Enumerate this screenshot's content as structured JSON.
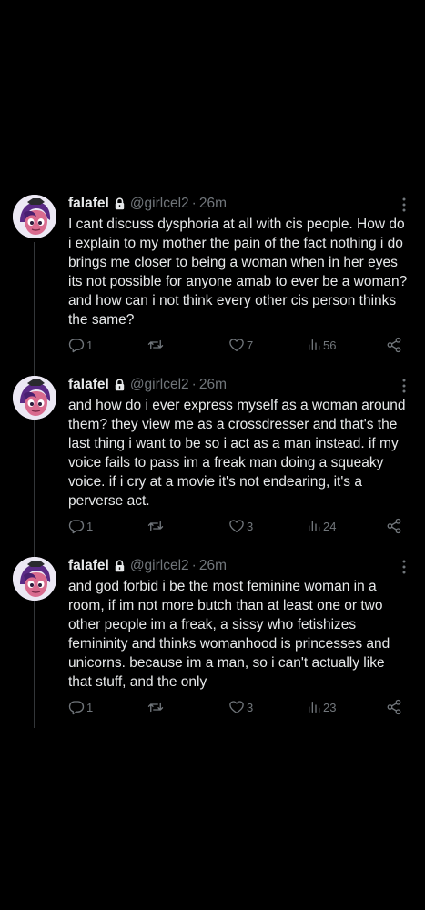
{
  "colors": {
    "background": "#000000",
    "text": "#e7e9ea",
    "muted": "#71767b",
    "thread_line": "#333639",
    "avatar_hair": "#5b2a86",
    "avatar_skin": "#d96b8f"
  },
  "tweets": [
    {
      "author_name": "falafel",
      "handle": "@girlcel2",
      "separator": "·",
      "time": "26m",
      "lines": [
        "I cant discuss dysphoria at all with cis people. How do",
        "i explain to my mother the pain of the fact nothing i do",
        "brings me closer to being a woman when in her eyes",
        "its not possible for anyone amab to ever be a woman?",
        "and how can i not think every other cis person thinks",
        "the same?"
      ],
      "replies": "1",
      "reposts": "",
      "likes": "7",
      "views": "56"
    },
    {
      "author_name": "falafel",
      "handle": "@girlcel2",
      "separator": "·",
      "time": "26m",
      "lines": [
        "and how do i ever express myself as a woman around",
        "them? they view me as a crossdresser and that's the",
        "last thing i want to be so i act as a man instead. if my",
        "voice fails to pass im a freak man doing a squeaky",
        "voice. if i cry at a movie it's not endearing, it's a",
        "perverse act."
      ],
      "replies": "1",
      "reposts": "",
      "likes": "3",
      "views": "24"
    },
    {
      "author_name": "falafel",
      "handle": "@girlcel2",
      "separator": "·",
      "time": "26m",
      "lines": [
        "and god forbid i be the most feminine woman in a",
        "room, if im not more butch than at least one or two",
        "other people im a freak, a sissy who fetishizes",
        "femininity and thinks womanhood is princesses and",
        "unicorns. because im a man, so i can't actually like",
        "that stuff, and the only"
      ],
      "replies": "1",
      "reposts": "",
      "likes": "3",
      "views": "23"
    }
  ],
  "icons": {
    "lock": "lock-icon",
    "more": "more-icon",
    "reply": "reply-icon",
    "repost": "repost-icon",
    "like": "heart-icon",
    "views": "views-icon",
    "share": "share-icon"
  }
}
